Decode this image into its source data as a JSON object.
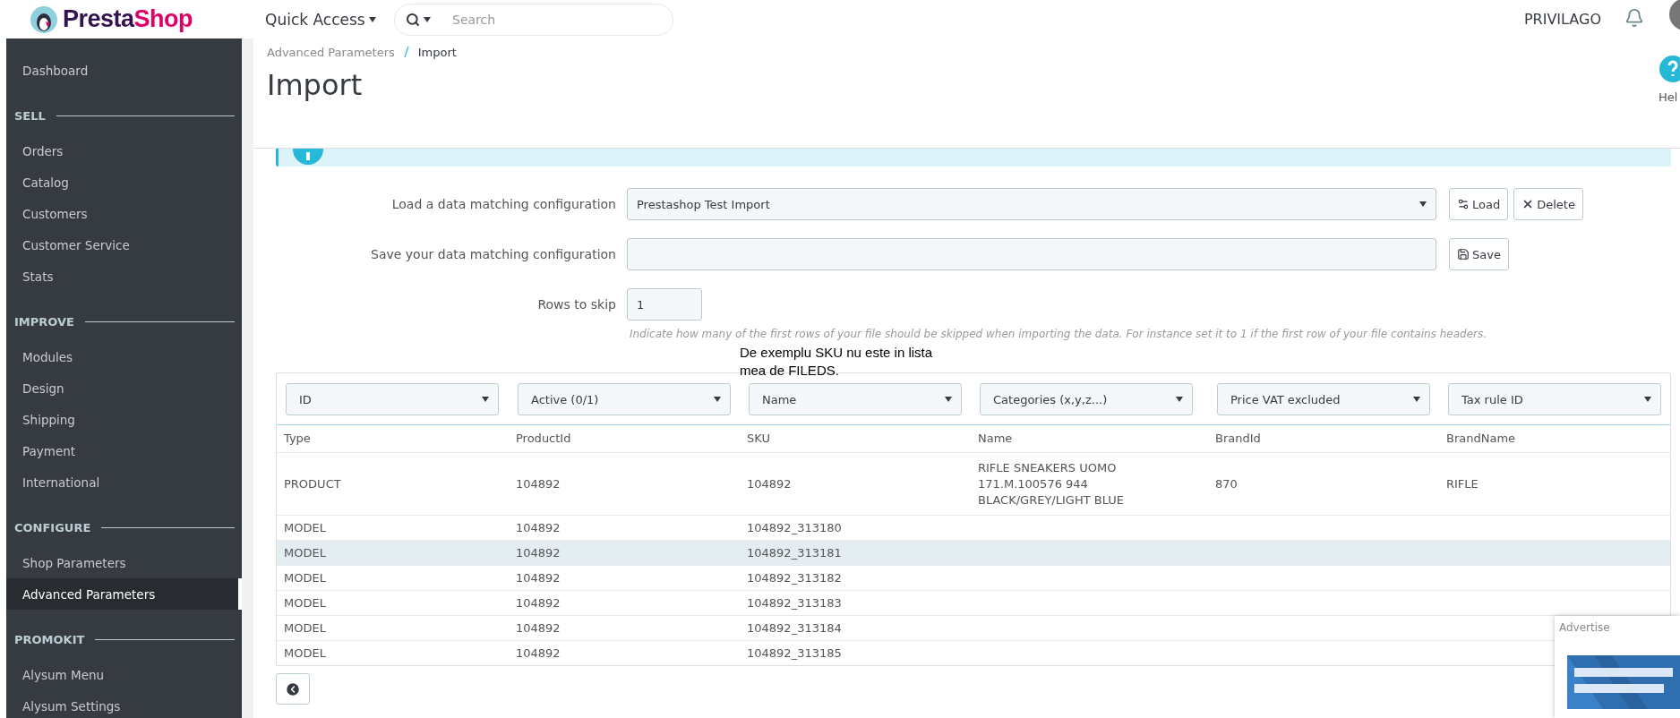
{
  "top_bar": {
    "logo": {
      "first": "Presta",
      "second": "Shop"
    },
    "quick_access": "Quick Access",
    "search": {
      "placeholder": "Search"
    },
    "shop_name": "PRIVILAGO"
  },
  "sidebar": {
    "items": [
      {
        "label": "Dashboard",
        "selected": false
      }
    ],
    "sections": [
      {
        "title": "SELL",
        "items": [
          {
            "label": "Orders",
            "selected": false
          },
          {
            "label": "Catalog",
            "selected": false
          },
          {
            "label": "Customers",
            "selected": false
          },
          {
            "label": "Customer Service",
            "selected": false
          },
          {
            "label": "Stats",
            "selected": false
          }
        ]
      },
      {
        "title": "IMPROVE",
        "items": [
          {
            "label": "Modules",
            "selected": false
          },
          {
            "label": "Design",
            "selected": false
          },
          {
            "label": "Shipping",
            "selected": false
          },
          {
            "label": "Payment",
            "selected": false
          },
          {
            "label": "International",
            "selected": false
          }
        ]
      },
      {
        "title": "CONFIGURE",
        "items": [
          {
            "label": "Shop Parameters",
            "selected": false
          },
          {
            "label": "Advanced Parameters",
            "selected": true
          }
        ]
      },
      {
        "title": "PROMOKIT",
        "items": [
          {
            "label": "Alysum Menu",
            "selected": false
          },
          {
            "label": "Alysum Settings",
            "selected": false
          }
        ]
      }
    ]
  },
  "breadcrumb": [
    "Advanced Parameters",
    "Import"
  ],
  "page_title": "Import",
  "help_label": "Hel",
  "form": {
    "load_label": "Load a data matching configuration",
    "load_value": "Prestashop Test Import",
    "load_button": "Load",
    "delete_button": "Delete",
    "save_label": "Save your data matching configuration",
    "save_button": "Save",
    "rows_label": "Rows to skip",
    "rows_value": "1",
    "help_text": "Indicate how many of the first rows of your file should be skipped when importing the data. For instance set it to 1 if the first row of your file contains headers."
  },
  "annotation_lines": [
    "De exemplu SKU nu este in lista",
    "mea de FILEDS."
  ],
  "table": {
    "field_selects": [
      "ID",
      "Active (0/1)",
      "Name",
      "Categories (x,y,z...)",
      "Price VAT excluded",
      "Tax rule ID"
    ],
    "columns": [
      "Type",
      "ProductId",
      "SKU",
      "Name",
      "BrandId",
      "BrandName"
    ],
    "rows": [
      {
        "hovered": false,
        "cells": [
          "PRODUCT",
          "104892",
          "104892",
          "RIFLE SNEAKERS UOMO 171.M.100576 944 BLACK/GREY/LIGHT BLUE",
          "870",
          "RIFLE"
        ]
      },
      {
        "hovered": false,
        "cells": [
          "MODEL",
          "104892",
          "104892_313180",
          "",
          "",
          ""
        ]
      },
      {
        "hovered": true,
        "cells": [
          "MODEL",
          "104892",
          "104892_313181",
          "",
          "",
          ""
        ]
      },
      {
        "hovered": false,
        "cells": [
          "MODEL",
          "104892",
          "104892_313182",
          "",
          "",
          ""
        ]
      },
      {
        "hovered": false,
        "cells": [
          "MODEL",
          "104892",
          "104892_313183",
          "",
          "",
          ""
        ]
      },
      {
        "hovered": false,
        "cells": [
          "MODEL",
          "104892",
          "104892_313184",
          "",
          "",
          ""
        ]
      },
      {
        "hovered": false,
        "cells": [
          "MODEL",
          "104892",
          "104892_313185",
          "",
          "",
          ""
        ]
      }
    ]
  },
  "advertise": {
    "title": "Advertise"
  }
}
